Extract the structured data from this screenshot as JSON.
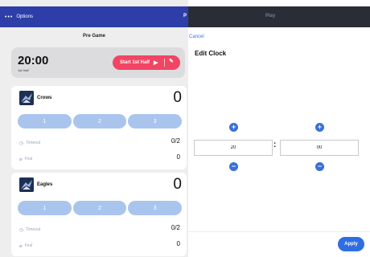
{
  "left_panel": {
    "topbar": {
      "menu_dots": "•••",
      "title": "Options",
      "right_glyph": "P"
    },
    "subheader": "Pre Game",
    "clock": {
      "time": "20:00",
      "half": "1st Half",
      "start_label": "Start 1st Half",
      "play_icon": "▶",
      "edit_icon": "✎"
    },
    "teams": [
      {
        "name": "Crows",
        "score": "0",
        "periods": [
          "1",
          "2",
          "3"
        ],
        "timeout_label": "Timeout",
        "timeout_value": "0/2",
        "foul_label": "Foul",
        "foul_value": "0"
      },
      {
        "name": "Eagles",
        "score": "0",
        "periods": [
          "1",
          "2",
          "3"
        ],
        "timeout_label": "Timeout",
        "timeout_value": "0/2",
        "foul_label": "Foul",
        "foul_value": "0"
      }
    ],
    "icons": {
      "timeout": "clock-icon",
      "foul": "whistle-icon"
    }
  },
  "right_panel": {
    "brand": "Play",
    "cancel_label": "Cancel",
    "title": "Edit Clock",
    "minutes": {
      "value": "20",
      "plus": "+",
      "minus": "−"
    },
    "seconds": {
      "value": "00",
      "plus": "+",
      "minus": "−"
    },
    "separator": ":",
    "apply_label": "Apply"
  },
  "colors": {
    "nav_blue": "#2d3ea8",
    "start_red": "#f24463",
    "period_blue": "#a9c5ee",
    "action_blue": "#3a6fd6",
    "dark_bar": "#2a2c36"
  }
}
